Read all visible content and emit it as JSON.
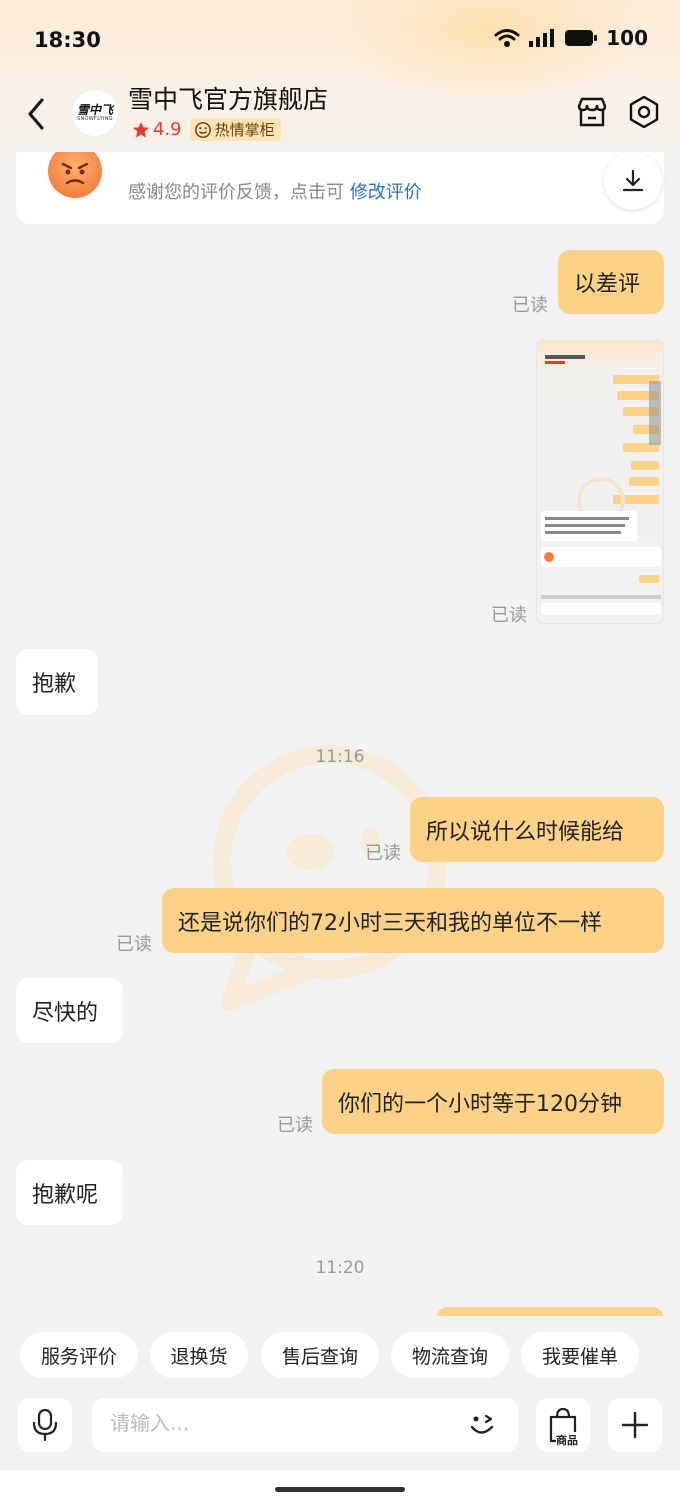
{
  "status": {
    "time": "18:30",
    "battery": "100"
  },
  "header": {
    "store_name": "雪中飞官方旗舰店",
    "rating": "4.9",
    "badge": "热情掌柜",
    "logo_text": "雪中飞",
    "logo_sub": "SNOWFLYING"
  },
  "review": {
    "text_prefix": "感谢您的评价反馈，点击可",
    "link": "修改评价"
  },
  "messages": {
    "m1": "以差评",
    "m1_read": "已读",
    "img_read": "已读",
    "m2": "抱歉",
    "time1": "11:16",
    "m3": "所以说什么时候能给",
    "m3_read": "已读",
    "m4": "还是说你们的72小时三天和我的单位不一样",
    "m4_read": "已读",
    "m5": "尽快的",
    "m6": "你们的一个小时等于120分钟",
    "m6_read": "已读",
    "m7": "抱歉呢",
    "time2": "11:20"
  },
  "quick_actions": [
    "服务评价",
    "退换货",
    "售后查询",
    "物流查询",
    "我要催单"
  ],
  "input": {
    "placeholder": "请输入...",
    "goods_label": "商品"
  },
  "colors": {
    "my_bubble": "#fbd288",
    "accent_red": "#e63a2e",
    "link_blue": "#2a6fd8"
  }
}
